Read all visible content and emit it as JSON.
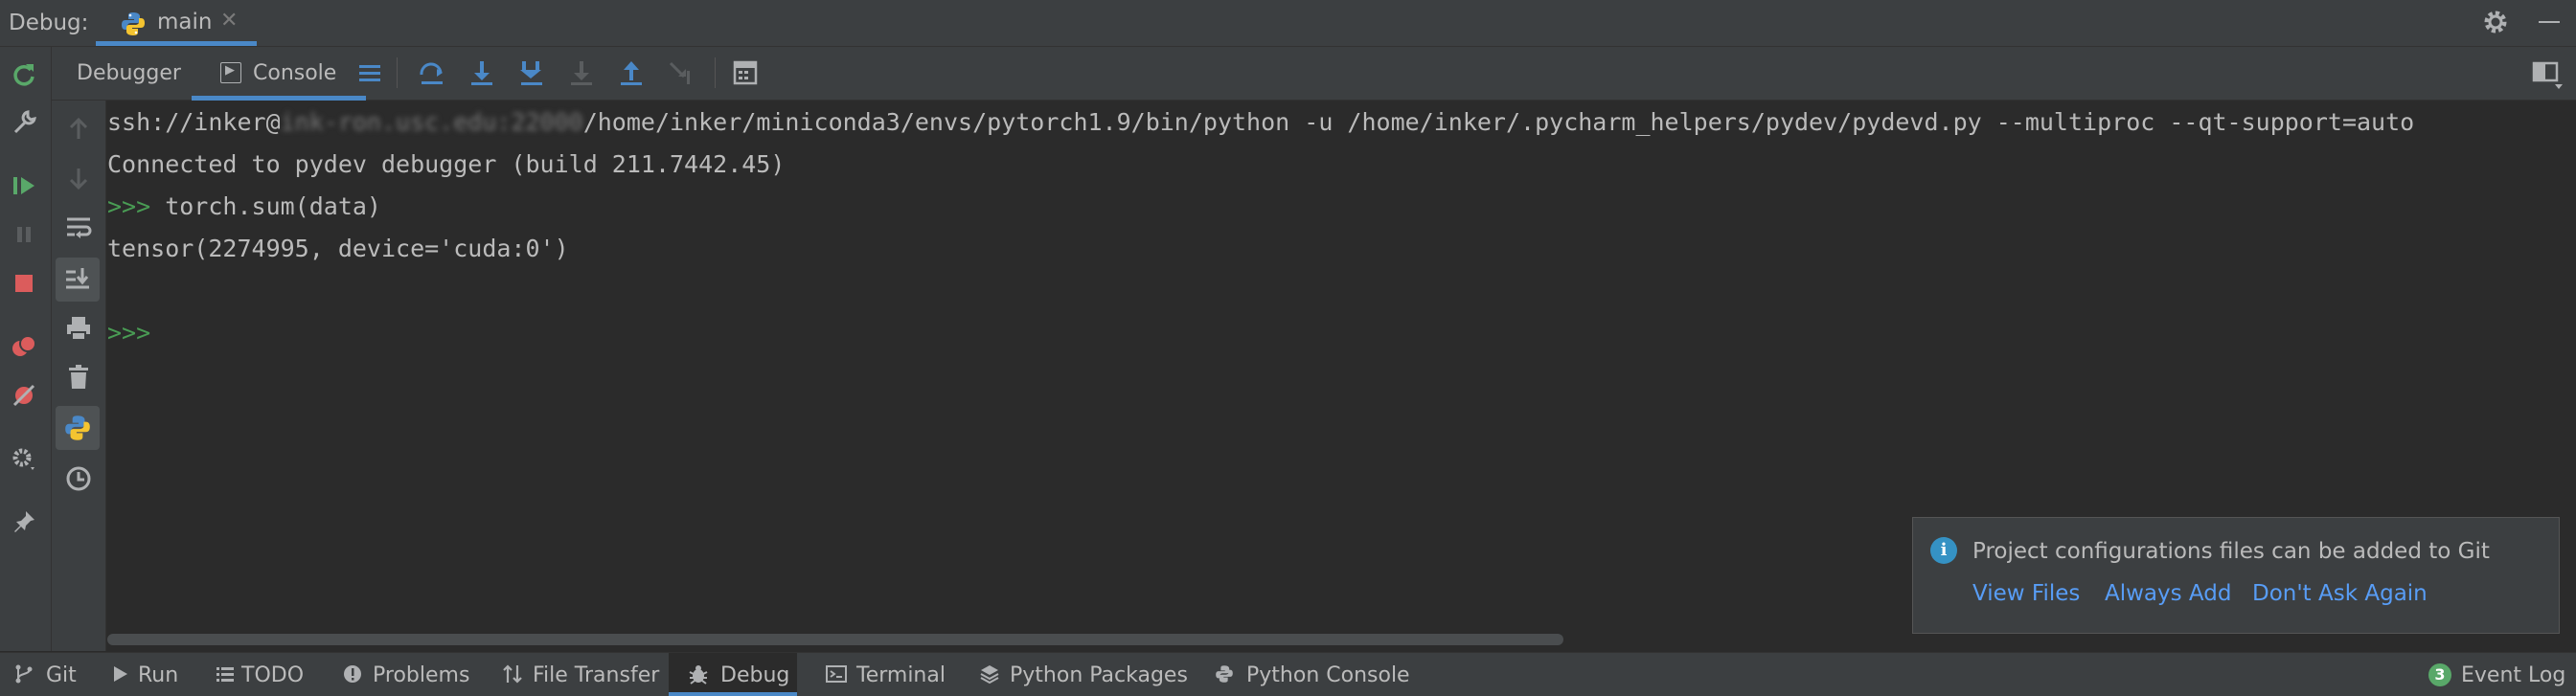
{
  "titlebar": {
    "label": "Debug:",
    "tab": "main"
  },
  "tabs": {
    "debugger": "Debugger",
    "console": "Console"
  },
  "console": {
    "line1_a": "ssh://inker@",
    "line1_masked": "ink-ron.usc.edu:22000",
    "line1_b": "/home/inker/miniconda3/envs/pytorch1.9/bin/python -u /home/inker/.pycharm_helpers/pydev/pydevd.py --multiproc --qt-support=auto",
    "line2": "Connected to pydev debugger (build 211.7442.45)",
    "prompt": ">>>",
    "line3_cmd": " torch.sum(data)",
    "line4": "tensor(2274995, device='cuda:0')",
    "prompt2": ">>>"
  },
  "notification": {
    "message": "Project configurations files can be added to Git",
    "links": [
      "View Files",
      "Always Add",
      "Don't Ask Again"
    ]
  },
  "bottombar": {
    "items": [
      "Git",
      "Run",
      "TODO",
      "Problems",
      "File Transfer",
      "Debug",
      "Terminal",
      "Python Packages",
      "Python Console"
    ],
    "event_log": "Event Log",
    "event_count": "3"
  },
  "colors": {
    "accent": "#4a88c7",
    "prompt": "#499c54",
    "link": "#589df6",
    "run_green": "#59a869",
    "stop_red": "#db5c5c"
  }
}
